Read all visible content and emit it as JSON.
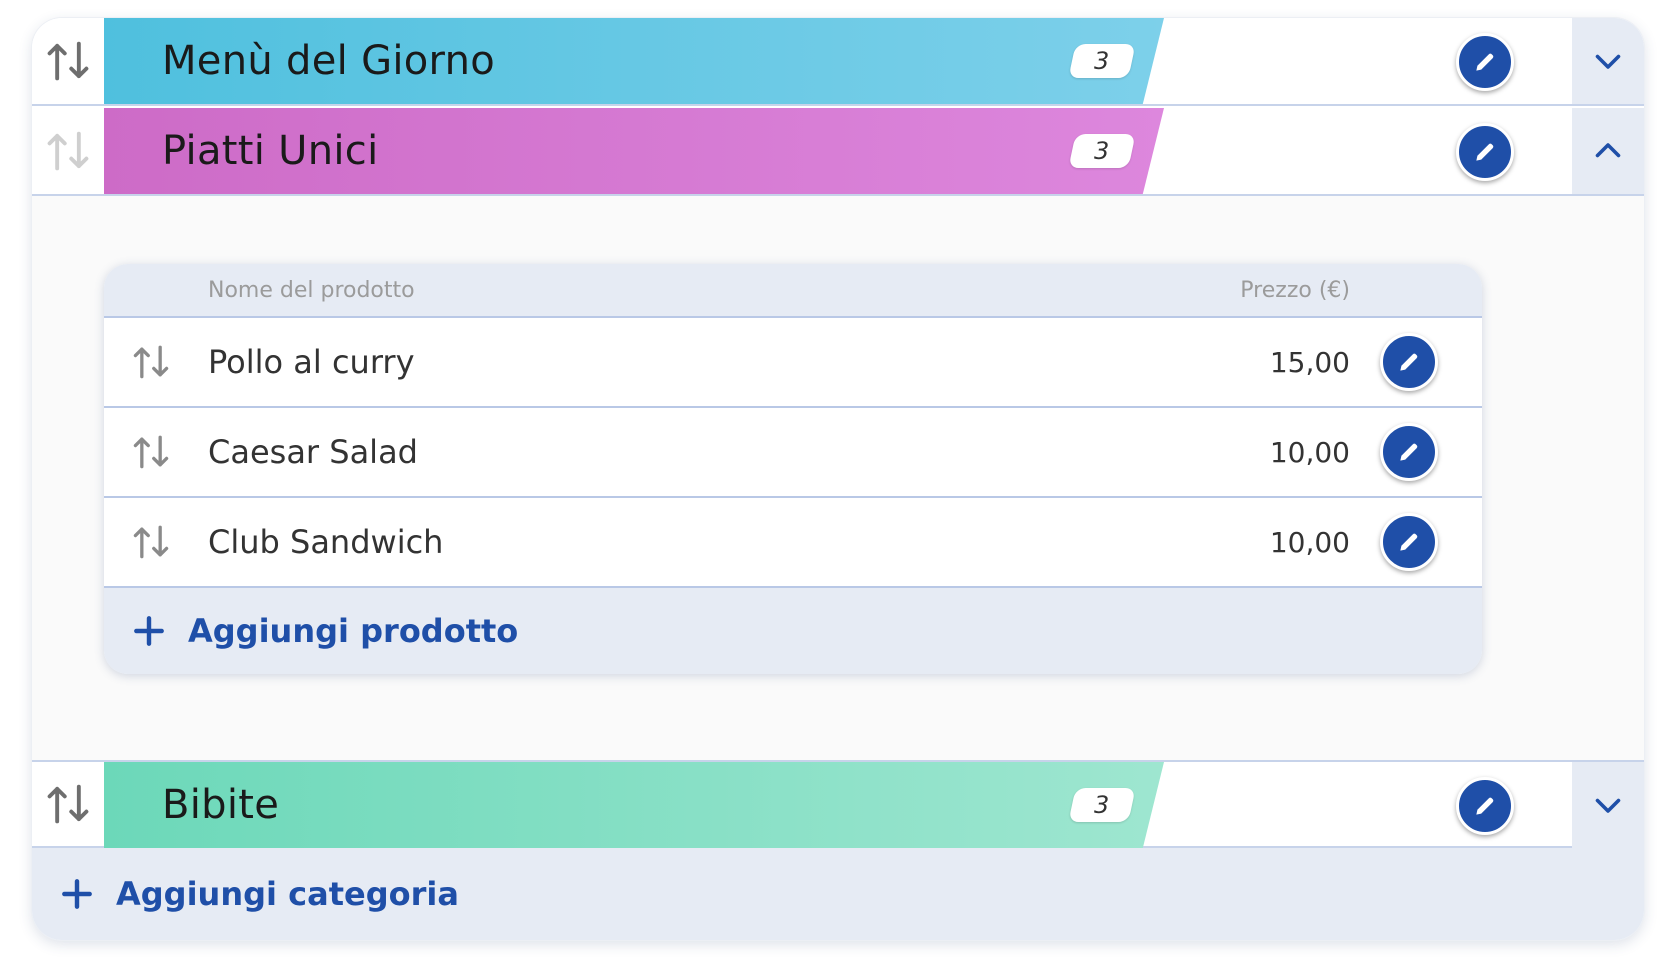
{
  "categories": [
    {
      "name": "Menù del Giorno",
      "count": "3",
      "expanded": false,
      "color": "#5cc6e2"
    },
    {
      "name": "Piatti Unici",
      "count": "3",
      "expanded": true,
      "color": "#d479d4"
    },
    {
      "name": "Bibite",
      "count": "3",
      "expanded": false,
      "color": "#7fdcc2"
    }
  ],
  "products_table": {
    "header_name": "Nome del prodotto",
    "header_price": "Prezzo (€)",
    "rows": [
      {
        "name": "Pollo al curry",
        "price": "15,00"
      },
      {
        "name": "Caesar Salad",
        "price": "10,00"
      },
      {
        "name": "Club Sandwich",
        "price": "10,00"
      }
    ],
    "add_label": "Aggiungi prodotto"
  },
  "add_category_label": "Aggiungi categoria",
  "icons": {
    "drag": "sort-arrows-icon",
    "edit": "pencil-icon",
    "expand": "chevron-down-icon",
    "collapse": "chevron-up-icon",
    "add": "plus-icon"
  },
  "colors": {
    "accent": "#1f4fa8",
    "panel_bg": "#e6ebf4"
  }
}
